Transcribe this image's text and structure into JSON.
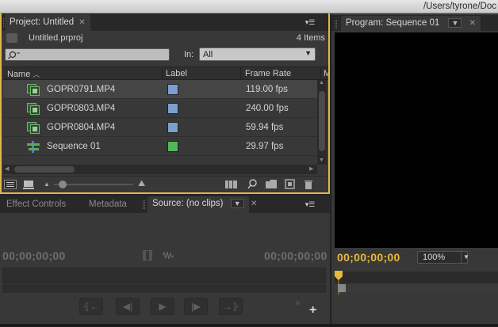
{
  "window": {
    "path": "/Users/tyrone/Doc"
  },
  "project_panel": {
    "tab_label": "Project: Untitled",
    "file_name": "Untitled.prproj",
    "item_count": "4 Items",
    "search_placeholder": "",
    "in_label": "In:",
    "in_value": "All",
    "columns": {
      "name": "Name",
      "label": "Label",
      "frame_rate": "Frame Rate",
      "more": "M"
    },
    "items": [
      {
        "name": "GOPR0791.MP4",
        "label_color": "#7b9fd1",
        "frame_rate": "119.00 fps",
        "icon": "video-clip-icon"
      },
      {
        "name": "GOPR0803.MP4",
        "label_color": "#7b9fd1",
        "frame_rate": "240.00 fps",
        "icon": "video-clip-icon"
      },
      {
        "name": "GOPR0804.MP4",
        "label_color": "#7b9fd1",
        "frame_rate": "59.94 fps",
        "icon": "video-clip-icon"
      },
      {
        "name": "Sequence 01",
        "label_color": "#54b55a",
        "frame_rate": "29.97 fps",
        "icon": "sequence-icon"
      }
    ]
  },
  "source_panel": {
    "tabs": [
      {
        "label": "Effect Controls"
      },
      {
        "label": "Metadata"
      },
      {
        "label": "Source: (no clips)"
      }
    ],
    "timecode_left": "00;00;00;00",
    "timecode_right": "00;00;00;00"
  },
  "program_panel": {
    "tab_label": "Program: Sequence 01",
    "timecode": "00;00;00;00",
    "zoom": "100%"
  },
  "colors": {
    "accent": "#e4b54a",
    "timecode_active": "#e8b83c"
  }
}
